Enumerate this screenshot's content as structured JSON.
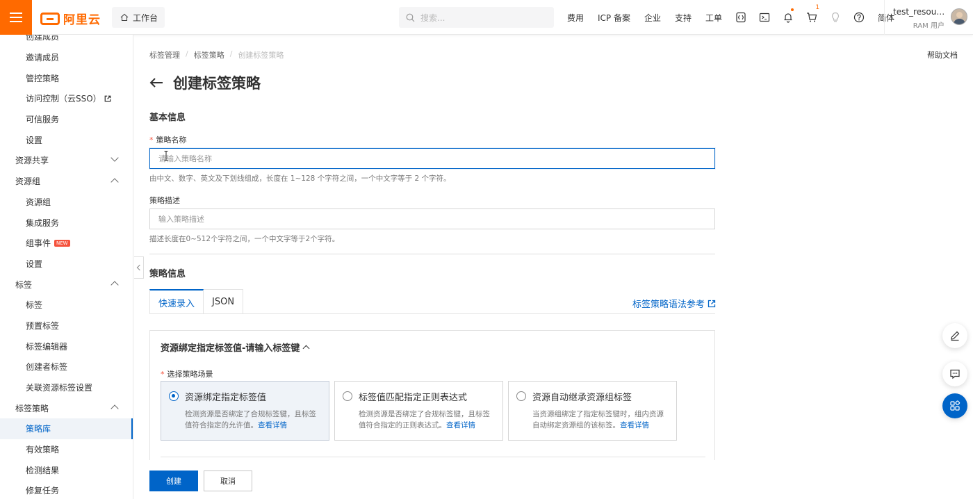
{
  "topbar": {
    "logo_text": "阿里云",
    "workbench_label": "工作台",
    "search_placeholder": "搜索...",
    "links": [
      "费用",
      "ICP 备案",
      "企业",
      "支持",
      "工单"
    ],
    "cart_count": "1",
    "language": "简体",
    "user_name": "test_resour...",
    "user_role": "RAM 用户"
  },
  "sidebar": {
    "items": [
      {
        "label": "创建成员",
        "type": "sub"
      },
      {
        "label": "邀请成员",
        "type": "sub"
      },
      {
        "label": "管控策略",
        "type": "sub"
      },
      {
        "label": "访问控制（云SSO）",
        "type": "sub",
        "external": true
      },
      {
        "label": "可信服务",
        "type": "sub"
      },
      {
        "label": "设置",
        "type": "sub"
      },
      {
        "label": "资源共享",
        "type": "group",
        "expanded": false
      },
      {
        "label": "资源组",
        "type": "group",
        "expanded": true
      },
      {
        "label": "资源组",
        "type": "sub"
      },
      {
        "label": "集成服务",
        "type": "sub"
      },
      {
        "label": "组事件",
        "type": "sub",
        "badge": "NEW"
      },
      {
        "label": "设置",
        "type": "sub"
      },
      {
        "label": "标签",
        "type": "group",
        "expanded": true
      },
      {
        "label": "标签",
        "type": "sub"
      },
      {
        "label": "预置标签",
        "type": "sub"
      },
      {
        "label": "标签编辑器",
        "type": "sub"
      },
      {
        "label": "创建者标签",
        "type": "sub"
      },
      {
        "label": "关联资源标签设置",
        "type": "sub"
      },
      {
        "label": "标签策略",
        "type": "group",
        "expanded": true
      },
      {
        "label": "策略库",
        "type": "sub",
        "active": true
      },
      {
        "label": "有效策略",
        "type": "sub"
      },
      {
        "label": "检测结果",
        "type": "sub"
      },
      {
        "label": "修复任务",
        "type": "sub"
      }
    ]
  },
  "breadcrumb": [
    "标签管理",
    "标签策略",
    "创建标签策略"
  ],
  "help_doc": "帮助文档",
  "page_title": "创建标签策略",
  "basic_section": "基本信息",
  "name_field": {
    "label": "策略名称",
    "placeholder": "请输入策略名称",
    "help": "由中文、数字、英文及下划线组成，长度在 1~128 个字符之间，一个中文字等于 2 个字符。"
  },
  "desc_field": {
    "label": "策略描述",
    "placeholder": "输入策略描述",
    "help": "描述长度在0~512个字符之间，一个中文字等于2个字符。"
  },
  "policy_section": "策略信息",
  "tabs": [
    "快速录入",
    "JSON"
  ],
  "syntax_link": "标签策略语法参考",
  "panel": {
    "title": "资源绑定指定标签值-请输入标签键",
    "scene_label": "选择策略场景",
    "cards": [
      {
        "title": "资源绑定指定标签值",
        "desc": "检测资源是否绑定了合规标签键，且标签值符合指定的允许值。",
        "link": "查看详情",
        "selected": true
      },
      {
        "title": "标签值匹配指定正则表达式",
        "desc": "检测资源是否绑定了合规标签键，且标签值符合指定的正则表达式。",
        "link": "查看详情",
        "selected": false
      },
      {
        "title": "资源自动继承资源组标签",
        "desc": "当资源组绑定了指定标签键时，组内资源自动绑定资源组的该标签。",
        "link": "查看详情",
        "selected": false
      }
    ]
  },
  "buttons": {
    "create": "创建",
    "cancel": "取消"
  }
}
